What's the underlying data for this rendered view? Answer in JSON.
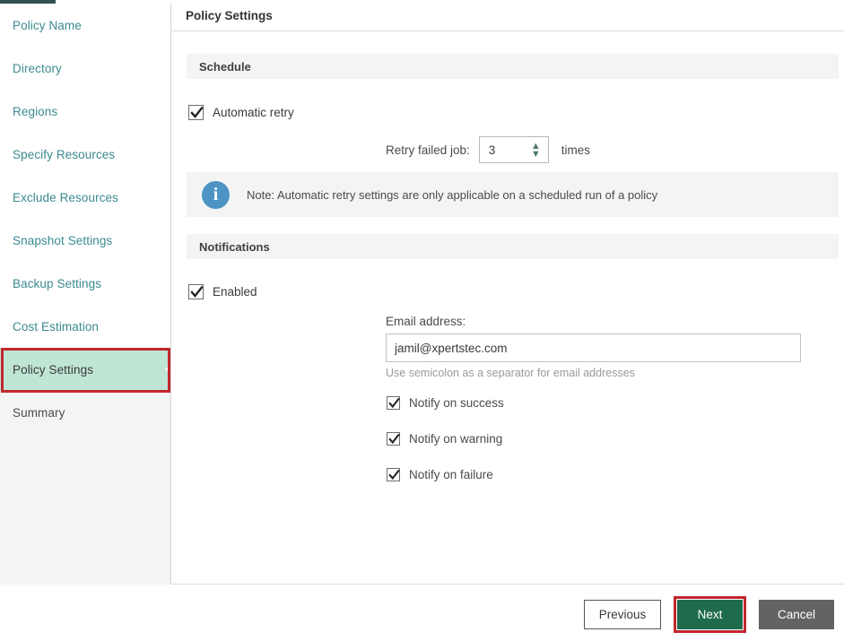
{
  "sidebar": {
    "items": [
      {
        "label": "Policy Name",
        "state": "link"
      },
      {
        "label": "Directory",
        "state": "link"
      },
      {
        "label": "Regions",
        "state": "link"
      },
      {
        "label": "Specify Resources",
        "state": "link"
      },
      {
        "label": "Exclude Resources",
        "state": "link"
      },
      {
        "label": "Snapshot Settings",
        "state": "link"
      },
      {
        "label": "Backup Settings",
        "state": "link"
      },
      {
        "label": "Cost Estimation",
        "state": "link"
      },
      {
        "label": "Policy Settings",
        "state": "selected"
      },
      {
        "label": "Summary",
        "state": "disabled"
      }
    ]
  },
  "main": {
    "title": "Policy Settings",
    "schedule": {
      "heading": "Schedule",
      "automatic_retry_label": "Automatic retry",
      "automatic_retry_checked": true,
      "retry_label": "Retry failed job:",
      "retry_value": "3",
      "retry_units": "times",
      "note": "Note: Automatic retry settings are only applicable on a scheduled run of a policy"
    },
    "notifications": {
      "heading": "Notifications",
      "enabled_label": "Enabled",
      "enabled_checked": true,
      "email_label": "Email address:",
      "email_value": "jamil@xpertstec.com",
      "email_placeholder": "Email address",
      "email_hint": "Use semicolon as a separator for email addresses",
      "options": [
        {
          "label": "Notify on success",
          "checked": true
        },
        {
          "label": "Notify on warning",
          "checked": true
        },
        {
          "label": "Notify on failure",
          "checked": true
        }
      ]
    }
  },
  "footer": {
    "previous_label": "Previous",
    "next_label": "Next",
    "cancel_label": "Cancel"
  },
  "colors": {
    "accent_green": "#1f6b4e",
    "selected_nav": "#bfe5d5",
    "annotation_red": "#c1272d",
    "link_teal": "#3b8a90",
    "info_blue": "#4d94c4",
    "cancel_gray": "#636363"
  }
}
